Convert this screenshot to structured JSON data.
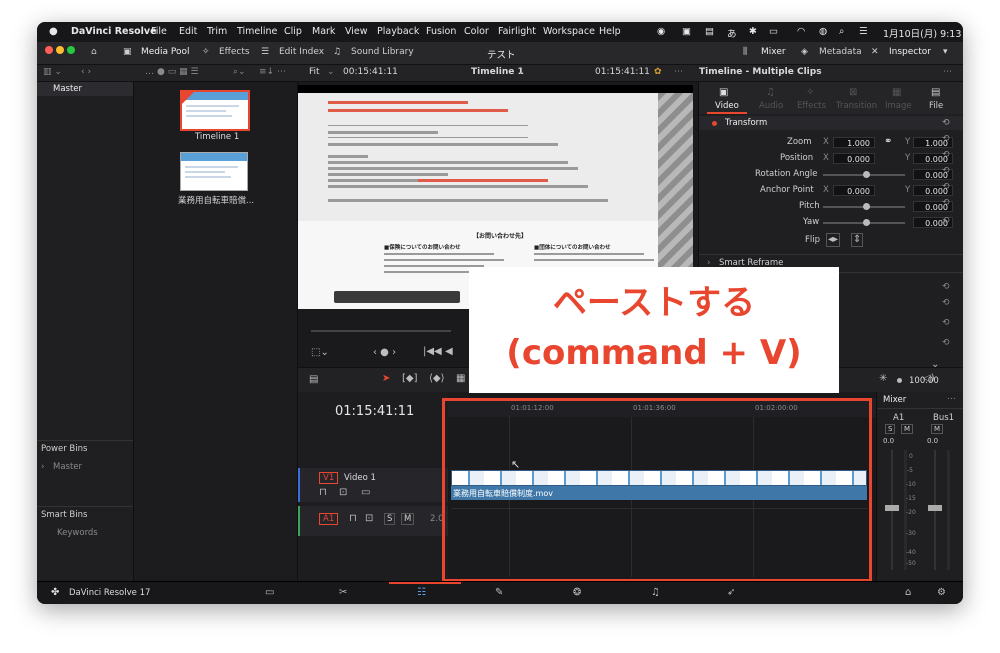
{
  "menubar": {
    "app": "DaVinci Resolve",
    "items": [
      "File",
      "Edit",
      "Trim",
      "Timeline",
      "Clip",
      "Mark",
      "View",
      "Playback",
      "Fusion",
      "Color",
      "Fairlight",
      "Workspace",
      "Help"
    ],
    "clock": "1月10日(月)  9:13"
  },
  "toolbar": {
    "media_pool": "Media Pool",
    "effects": "Effects",
    "edit_index": "Edit Index",
    "sound_library": "Sound Library",
    "title": "テスト",
    "mixer": "Mixer",
    "metadata": "Metadata",
    "inspector": "Inspector"
  },
  "subbar": {
    "fit": "Fit",
    "timecode_left": "00:15:41:11",
    "timeline_name": "Timeline 1",
    "timecode_right": "01:15:41:11",
    "inspector_title": "Timeline - Multiple Clips"
  },
  "media_pool": {
    "bin": "Master",
    "clips": [
      {
        "label": "Timeline 1"
      },
      {
        "label": "業務用自転車賠償..."
      }
    ],
    "power_bins": "Power Bins",
    "power_master": "Master",
    "smart_bins": "Smart Bins",
    "keywords": "Keywords"
  },
  "inspector": {
    "tabs": [
      "Video",
      "Audio",
      "Effects",
      "Transition",
      "Image",
      "File"
    ],
    "section": "Transform",
    "rows": [
      {
        "label": "Zoom",
        "x": "1.000",
        "y": "1.000"
      },
      {
        "label": "Position",
        "x": "0.000",
        "y": "0.000"
      },
      {
        "label": "Rotation Angle",
        "v": "0.000"
      },
      {
        "label": "Anchor Point",
        "x": "0.000",
        "y": "0.000"
      },
      {
        "label": "Pitch",
        "v": "0.000"
      },
      {
        "label": "Yaw",
        "v": "0.000"
      },
      {
        "label": "Flip"
      }
    ],
    "smart_reframe": "Smart Reframe",
    "x_label": "X",
    "y_label": "Y",
    "opacity": "100.00"
  },
  "timeline": {
    "timecode": "01:15:41:11",
    "ruler": [
      "01:01:12:00",
      "01:01:36:00",
      "01:02:00:00"
    ],
    "video_track": {
      "id": "V1",
      "name": "Video 1"
    },
    "audio_track": {
      "id": "A1",
      "level": "2.0"
    },
    "clip_name": "業務用自転車賠償制度.mov",
    "s_label": "S",
    "m_label": "M"
  },
  "mixer": {
    "title": "Mixer",
    "channels": [
      "A1",
      "Bus1"
    ],
    "level": "0.0",
    "scale": [
      "0",
      "-5",
      "-10",
      "-15",
      "-20",
      "-30",
      "-40",
      "-50"
    ]
  },
  "footer": {
    "app_version": "DaVinci Resolve 17"
  },
  "annotation": {
    "line1": "ペーストする",
    "line2": "(command + V)"
  },
  "document": {
    "heading": "【お問い合わせ先】",
    "box_left": "■保険についてのお問い合わせ",
    "box_right": "■団体についてのお問い合わせ"
  },
  "colors": {
    "accent_red": "#e8462f",
    "clip_blue": "#3f78a8",
    "panel_bg": "#1f1f22"
  }
}
